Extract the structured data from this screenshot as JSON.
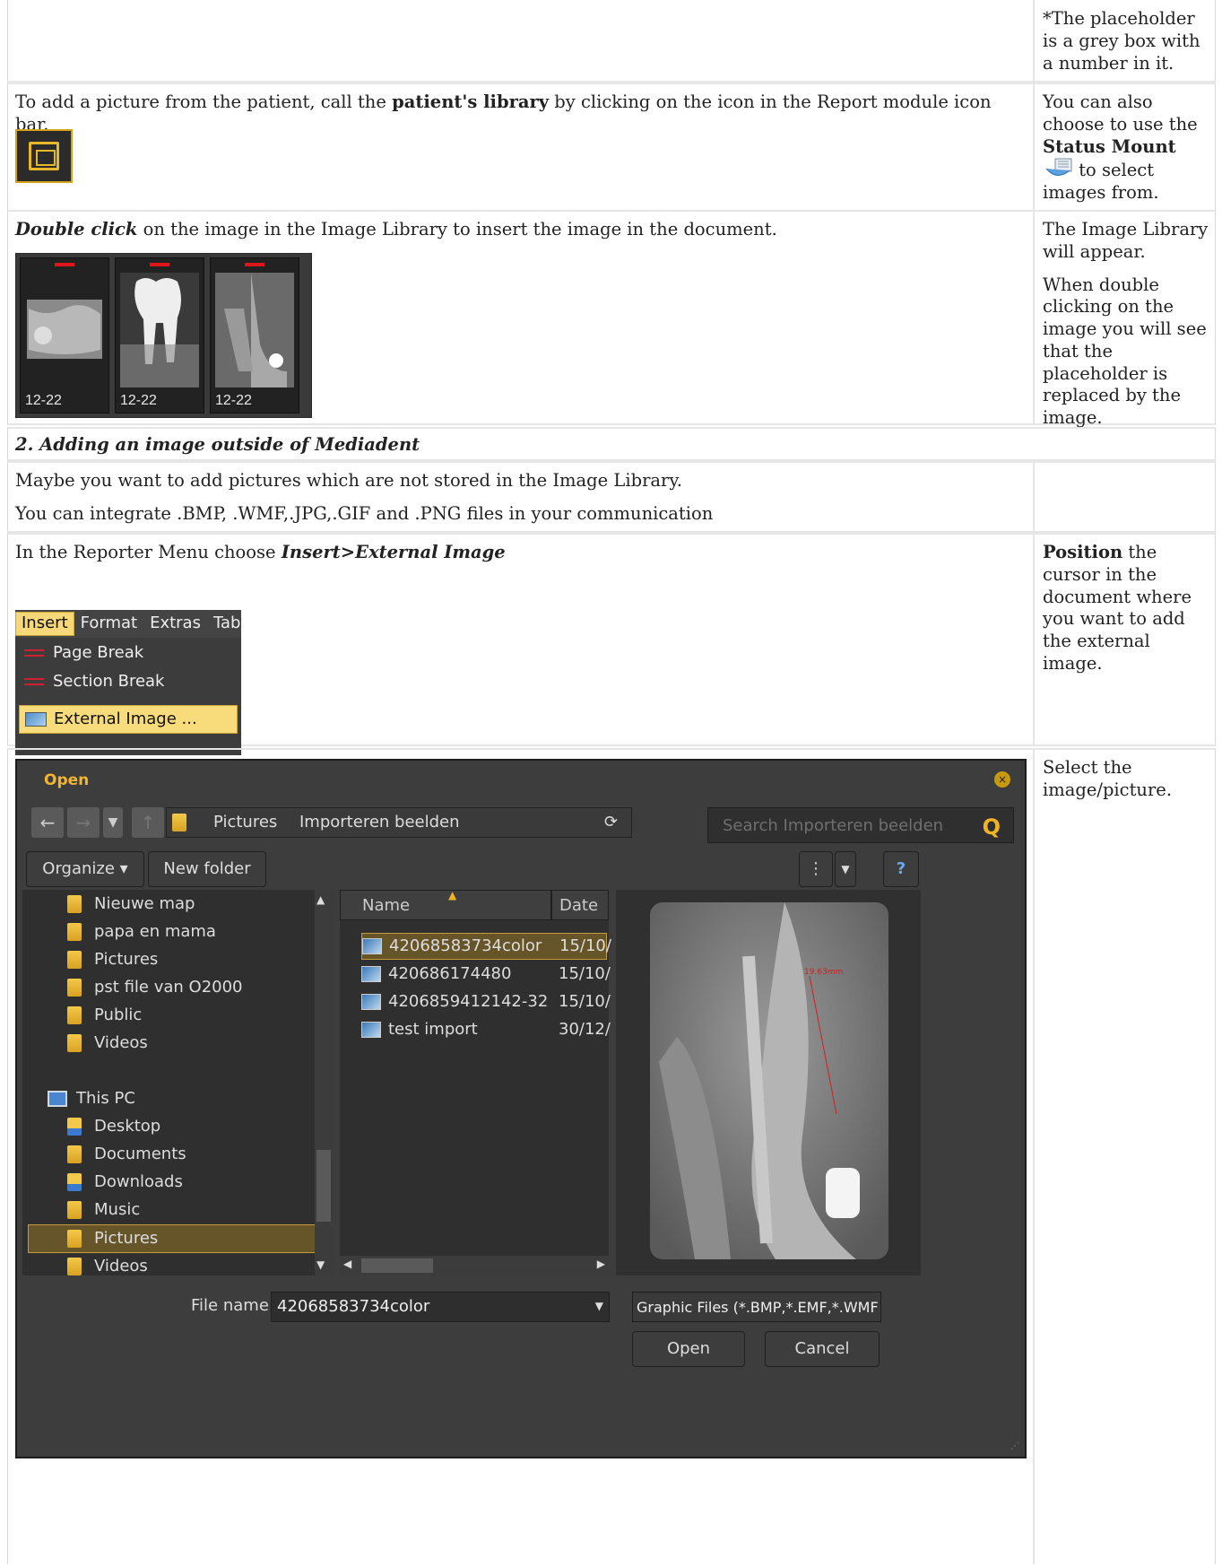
{
  "row0": {
    "right": "*The placeholder is a grey box with a number in it."
  },
  "row1": {
    "left": {
      "t1": "To add a picture from the patient, call the ",
      "b1": "patient's library",
      "t2": " by clicking on the icon in the Report module icon bar."
    },
    "icon": "image-library-icon",
    "right": {
      "t1": "You can also choose to use the ",
      "b1": "Status Mount",
      "t2": " to select images from."
    }
  },
  "row2": {
    "left": {
      "b1": "Double click",
      "t1": " on the image in the Image Library to insert the image in the document."
    },
    "thumbs": [
      "12-22",
      "12-22",
      "12-22"
    ],
    "right": {
      "p1": "The Image Library will appear.",
      "p2": "When double clicking on the image you will see that the placeholder is replaced by the image."
    }
  },
  "row3": {
    "heading": "2. Adding an image outside of Mediadent"
  },
  "row4": {
    "p1": "Maybe you want to add  pictures which are not stored in the Image Library.",
    "p2": "You can integrate .BMP, .WMF,.JPG,.GIF and .PNG files in your communication"
  },
  "row5": {
    "left": {
      "t1": "In the Reporter Menu choose ",
      "b1": "Insert>External Image"
    },
    "menu": {
      "bar": [
        "Insert",
        "Format",
        "Extras",
        "Tab"
      ],
      "items": [
        "Page Break",
        "Section Break",
        "External Image ..."
      ]
    },
    "right": {
      "b1": "Position",
      "t1": " the cursor in the document where you want to add the external image."
    }
  },
  "row6": {
    "right": "Select the image/picture.",
    "dialog": {
      "title": "Open",
      "breadcrumb": [
        "Pictures",
        "Importeren beelden"
      ],
      "search_placeholder": "Search Importeren beelden",
      "organize": "Organize",
      "new_folder": "New folder",
      "tree": [
        "Nieuwe map",
        "papa en mama",
        "Pictures",
        "pst file van O2000",
        "Public",
        "Videos"
      ],
      "this_pc": "This PC",
      "pc_items": [
        "Desktop",
        "Documents",
        "Downloads",
        "Music",
        "Pictures",
        "Videos"
      ],
      "columns": [
        "Name",
        "Date"
      ],
      "files": [
        {
          "name": "42068583734color",
          "date": "15/10/"
        },
        {
          "name": "420686174480",
          "date": "15/10/"
        },
        {
          "name": "4206859412142-32",
          "date": "15/10/"
        },
        {
          "name": "test import",
          "date": "30/12/"
        }
      ],
      "measure": "19.63mm",
      "file_name_label": "File name:",
      "file_name_value": "42068583734color",
      "filter": "Graphic Files (*.BMP,*.EMF,*.WMF",
      "open": "Open",
      "cancel": "Cancel"
    }
  }
}
